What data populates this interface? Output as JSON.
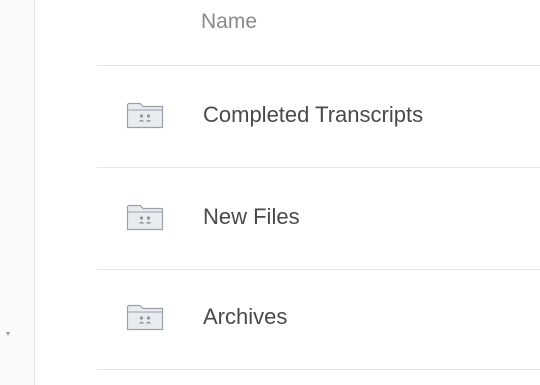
{
  "list": {
    "column_header": "Name",
    "items": [
      {
        "name": "Completed Transcripts",
        "icon": "shared-folder-icon"
      },
      {
        "name": "New Files",
        "icon": "shared-folder-icon"
      },
      {
        "name": "Archives",
        "icon": "shared-folder-icon"
      }
    ]
  },
  "colors": {
    "folder_fill": "#e9ecef",
    "folder_stroke": "#9aa1a8",
    "text": "#4a4a4a",
    "header_text": "#8a8a8a",
    "divider": "#e5e5e5"
  }
}
